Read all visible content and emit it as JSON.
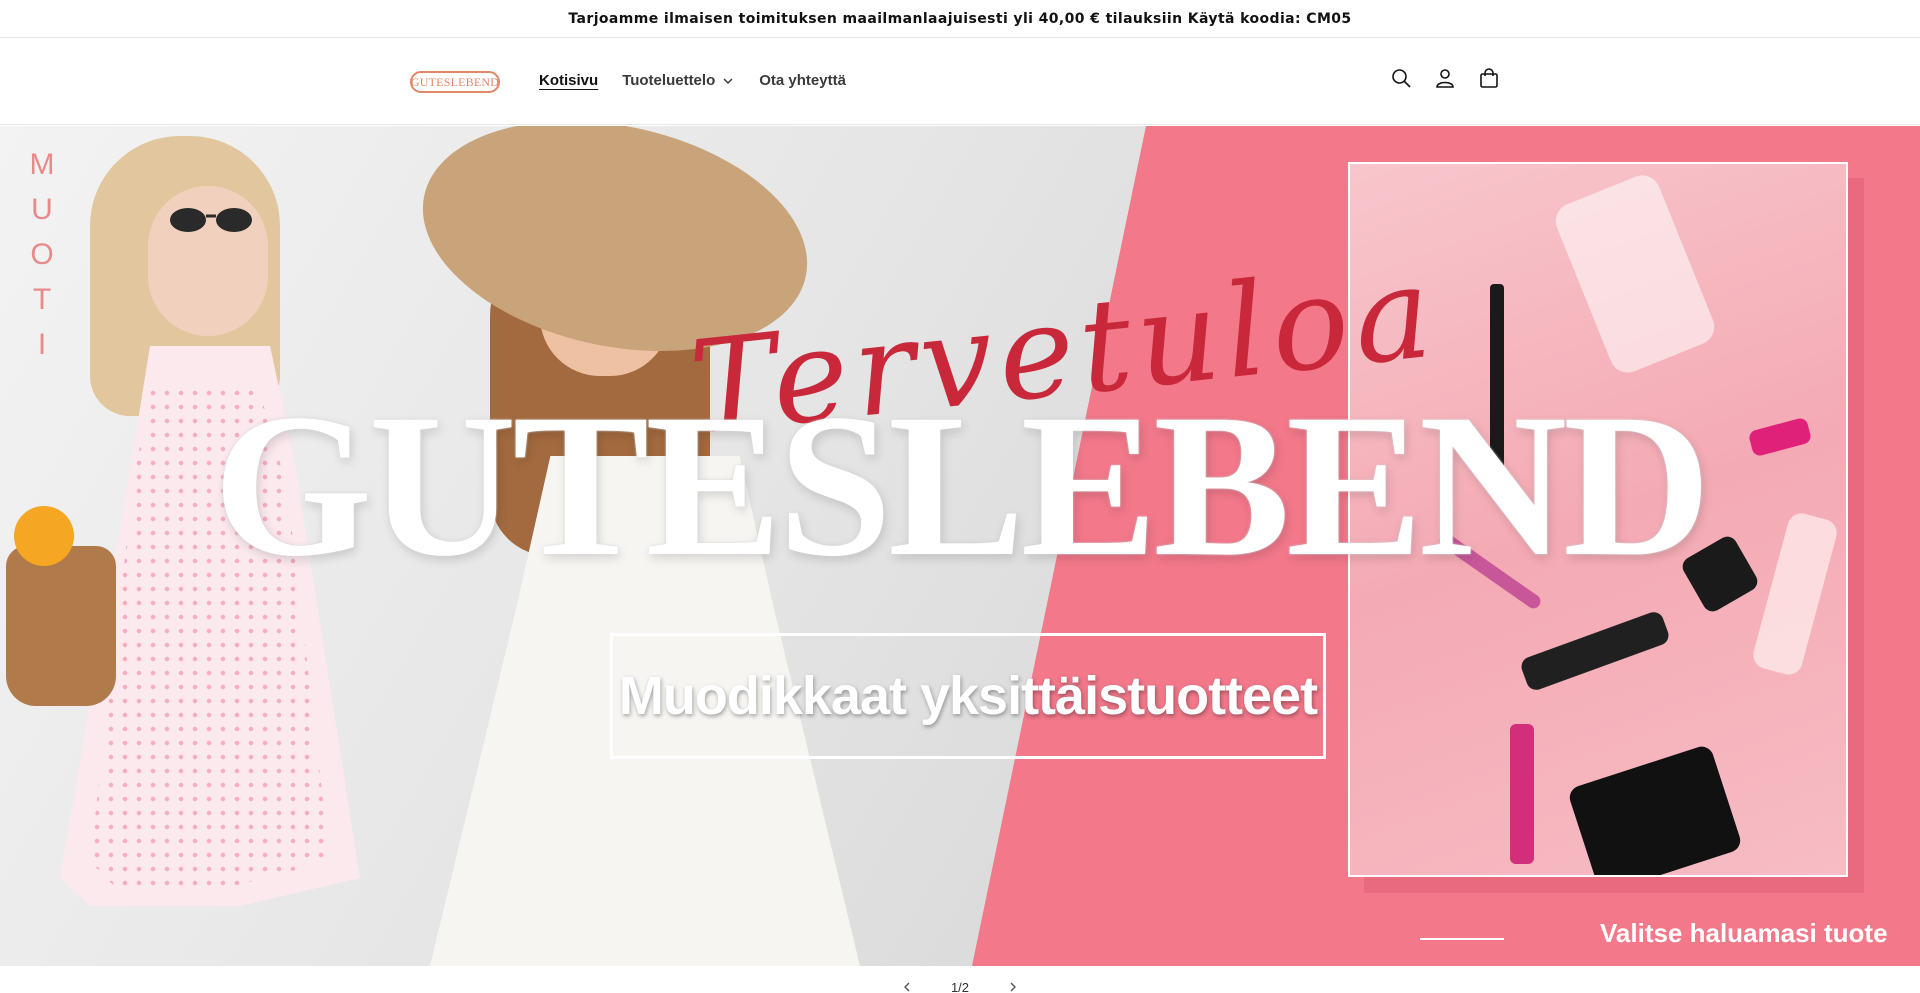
{
  "announcement": {
    "text": "Tarjoamme ilmaisen toimituksen maailmanlaajuisesti yli 40,00 € tilauksiin  Käytä koodia: CM05"
  },
  "header": {
    "logo_text": "GUTESLEBEND",
    "nav": [
      {
        "label": "Kotisivu",
        "active": true
      },
      {
        "label": "Tuoteluettelo",
        "has_dropdown": true
      },
      {
        "label": "Ota yhteyttä"
      }
    ],
    "icons": [
      "search-icon",
      "account-icon",
      "cart-icon"
    ]
  },
  "hero": {
    "side_text": [
      "M",
      "U",
      "O",
      "T",
      "I"
    ],
    "script_text": "Tervetuloa",
    "brand": "GUTESLEBEND",
    "tagline": "Muodikkaat yksittäistuotteet",
    "choose_text": "Valitse haluamasi tuote",
    "colors": {
      "pink": "#f2788a",
      "script": "#c9283a",
      "accent": "#e2866a"
    }
  },
  "slider": {
    "counter": "1/2",
    "current": 1,
    "total": 2
  }
}
